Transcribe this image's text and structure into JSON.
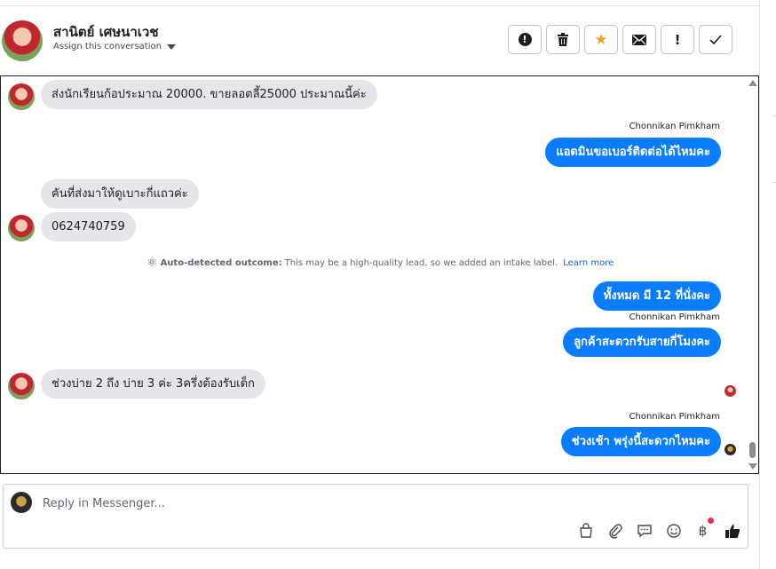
{
  "contact": {
    "name": "สานิตย์ เศษนาเวช",
    "assign_label": "Assign this conversation"
  },
  "toolbar": {
    "buttons": [
      {
        "icon": "alert-circle-icon"
      },
      {
        "icon": "trash-icon"
      },
      {
        "icon": "star-icon",
        "color": "#f5a623"
      },
      {
        "icon": "envelope-icon"
      },
      {
        "icon": "exclamation-icon"
      },
      {
        "icon": "check-icon"
      }
    ]
  },
  "messages": {
    "m1": "ส่งนักเรียนก้อประมาณ 20000. ขายลอตลี้25000 ประมาณนี้ค่ะ",
    "sender1": "Chonnikan Pimkham",
    "m2": "แอดมินขอเบอร์ติดต่อได้ไหมคะ",
    "m3": "คันที่ส่งมาให้ดูเบาะกี่แถวค่ะ",
    "m4": "0624740759",
    "auto_label": "Auto-detected outcome:",
    "auto_text": "This may be a high-quality lead, so we added an intake label.",
    "auto_link": "Learn more",
    "m5": "ทั้งหมด มี 12 ที่นั่งคะ",
    "sender2": "Chonnikan Pimkham",
    "m6": "ลูกค้าสะดวกรับสายกี่โมงคะ",
    "m7": "ช่วงบ่าย 2 ถึง บ่าย 3 ค่ะ 3ครึ่งต้องรับเด็ก",
    "sender3": "Chonnikan Pimkham",
    "m8": "ช่วงเช้า พรุ่งนี้สะดวกไหมคะ"
  },
  "composer": {
    "placeholder": "Reply in Messenger...",
    "baht_symbol": "฿"
  },
  "colors": {
    "outgoing_bubble": "#0a7cff",
    "incoming_bubble": "#e4e6eb",
    "link": "#1a63d6",
    "notification_dot": "#f02849"
  }
}
